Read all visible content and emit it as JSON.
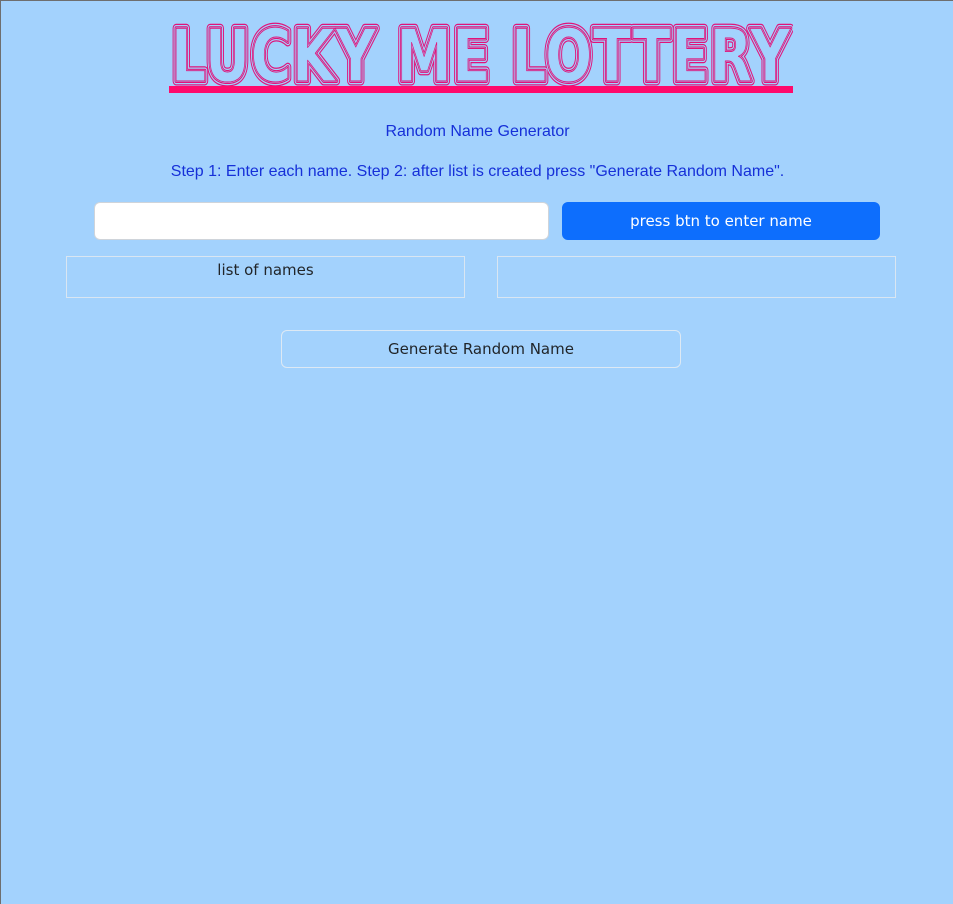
{
  "header": {
    "title": "LUCKY ME LOTTERY",
    "title_color": "#e0137a",
    "underline_color": "#ff0a6c"
  },
  "intro": {
    "subtitle": "Random Name Generator",
    "instructions": "Step 1: Enter each name. Step 2: after list is created press \"Generate Random Name\"."
  },
  "entry": {
    "input_value": "",
    "input_placeholder": "",
    "button_label": "press btn to enter name"
  },
  "names": {
    "list_label": "list of names",
    "result_text": ""
  },
  "actions": {
    "generate_label": "Generate Random Name"
  },
  "colors": {
    "background": "#a3d2fd",
    "text_blue": "#1630d8",
    "primary_button": "#0d6efd"
  }
}
